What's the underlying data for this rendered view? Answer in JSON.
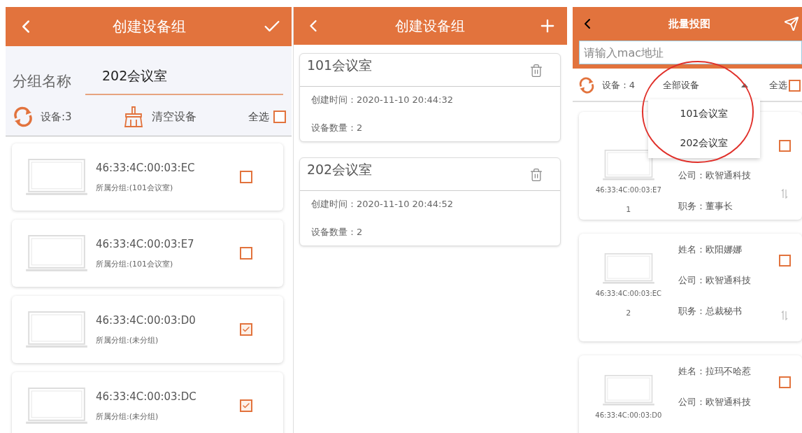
{
  "group_editor": {
    "title": "创建设备组",
    "name_label": "分组名称",
    "name_value": "202会议室",
    "device_count": "设备:3",
    "clear_label": "清空设备",
    "select_all_label": "全选",
    "select_all_checked": false,
    "devices": [
      {
        "mac": "46:33:4C:00:03:EC",
        "group": "所属分组:(101会议室)",
        "checked": false
      },
      {
        "mac": "46:33:4C:00:03:E7",
        "group": "所属分组:(101会议室)",
        "checked": false
      },
      {
        "mac": "46:33:4C:00:03:D0",
        "group": "所属分组:(未分组)",
        "checked": true
      },
      {
        "mac": "46:33:4C:00:03:DC",
        "group": "所属分组:(未分组)",
        "checked": true
      }
    ]
  },
  "group_list": {
    "title": "创建设备组",
    "groups": [
      {
        "name": "101会议室",
        "created": "创建时间：2020-11-10 20:44:32",
        "count": "设备数量：2"
      },
      {
        "name": "202会议室",
        "created": "创建时间：2020-11-10 20:44:52",
        "count": "设备数量：2"
      }
    ]
  },
  "batch_cast": {
    "title": "批量投图",
    "search_placeholder": "请输入mac地址",
    "device_count": "设备：4",
    "filter": {
      "value": "全部设备",
      "expanded": true,
      "options": [
        "101会议室",
        "202会议室"
      ]
    },
    "select_all_label": "全选",
    "select_all_checked": false,
    "devices": [
      {
        "company": "公司：欧智通科技",
        "role": "职务：董事长",
        "mac": "46:33:4C:00:03:E7",
        "index": "1",
        "checked": false
      },
      {
        "name": "姓名：欧阳娜娜",
        "company": "公司：欧智通科技",
        "role": "职务：总裁秘书",
        "mac": "46:33:4C:00:03:EC",
        "index": "2",
        "checked": false
      },
      {
        "name": "姓名：拉玛不哈惹",
        "company": "公司：欧智通科技",
        "mac": "46:33:4C:00:03:D0",
        "checked": false
      }
    ]
  }
}
